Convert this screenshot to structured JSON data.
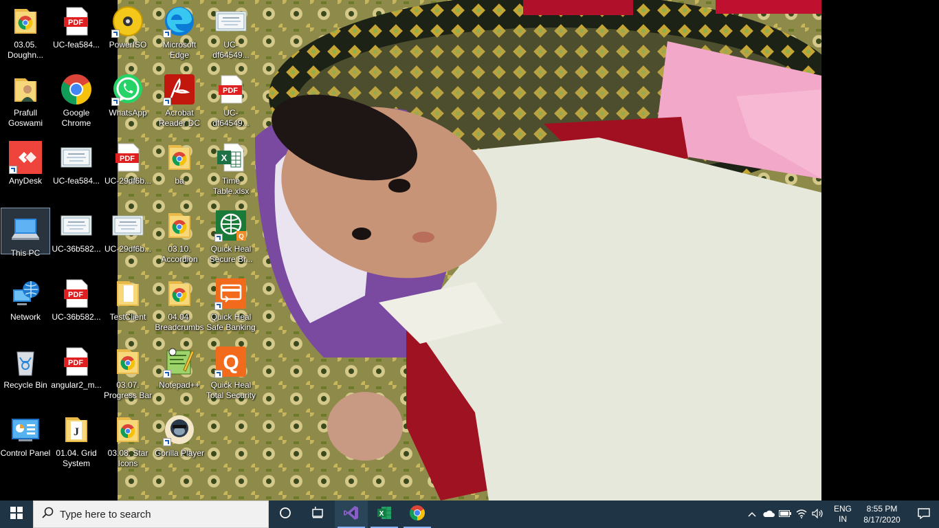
{
  "desktop": {
    "icons": [
      {
        "label": "03.05. Doughn...",
        "icon": "chrome-folder-icon"
      },
      {
        "label": "UC-fea584...",
        "icon": "pdf-icon"
      },
      {
        "label": "PowerISO",
        "icon": "poweriso-icon"
      },
      {
        "label": "Microsoft Edge",
        "icon": "edge-icon"
      },
      {
        "label": "UC-df64549...",
        "icon": "certificate-icon"
      },
      {
        "label": "Prafull Goswami",
        "icon": "user-folder-icon"
      },
      {
        "label": "Google Chrome",
        "icon": "chrome-icon"
      },
      {
        "label": "WhatsApp",
        "icon": "whatsapp-icon"
      },
      {
        "label": "Acrobat Reader DC",
        "icon": "acrobat-icon"
      },
      {
        "label": "UC-df64549...",
        "icon": "pdf-icon"
      },
      {
        "label": "AnyDesk",
        "icon": "anydesk-icon"
      },
      {
        "label": "UC-fea584...",
        "icon": "certificate-icon"
      },
      {
        "label": "UC-29df6b...",
        "icon": "pdf-icon"
      },
      {
        "label": "ba",
        "icon": "chrome-folder-icon"
      },
      {
        "label": "Time Table.xlsx",
        "icon": "excel-file-icon"
      },
      {
        "label": "This PC",
        "icon": "this-pc-icon"
      },
      {
        "label": "UC-36b582...",
        "icon": "certificate-icon"
      },
      {
        "label": "UC-29df6b...",
        "icon": "certificate-icon"
      },
      {
        "label": "03.10. Accordion",
        "icon": "chrome-folder-icon"
      },
      {
        "label": "Quick Heal Secure Br...",
        "icon": "quickheal-browser-icon"
      },
      {
        "label": "Network",
        "icon": "network-icon"
      },
      {
        "label": "UC-36b582...",
        "icon": "pdf-icon"
      },
      {
        "label": "TestClient",
        "icon": "folder-icon"
      },
      {
        "label": "04.04. Breadcrumbs",
        "icon": "chrome-folder-icon"
      },
      {
        "label": "Quick Heal Safe Banking",
        "icon": "quickheal-banking-icon"
      },
      {
        "label": "Recycle Bin",
        "icon": "recycle-bin-icon"
      },
      {
        "label": "angular2_m...",
        "icon": "pdf-icon"
      },
      {
        "label": "03.07. Progress Bar",
        "icon": "chrome-folder-icon"
      },
      {
        "label": "Notepad++",
        "icon": "notepadpp-icon"
      },
      {
        "label": "Quick Heal Total Security",
        "icon": "quickheal-q-icon"
      },
      {
        "label": "Control Panel",
        "icon": "control-panel-icon"
      },
      {
        "label": "01.04. Grid System",
        "icon": "j-folder-icon"
      },
      {
        "label": "03.08. Star Icons",
        "icon": "chrome-folder-icon"
      },
      {
        "label": "Gorilla Player",
        "icon": "gorilla-player-icon"
      }
    ],
    "selected": "This PC"
  },
  "taskbar": {
    "search_placeholder": "Type here to search",
    "apps": [
      "visual-studio-icon",
      "excel-icon",
      "chrome-icon"
    ],
    "lang_line1": "ENG",
    "lang_line2": "IN",
    "time": "8:55 PM",
    "date": "8/17/2020"
  },
  "colors": {
    "taskbar": "#1f3444",
    "search_bg": "#f1f1f1",
    "active_indicator": "#8ab4f8"
  }
}
